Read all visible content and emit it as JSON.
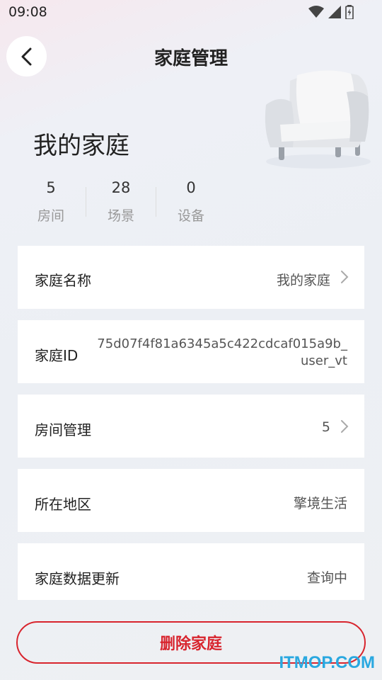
{
  "status_bar": {
    "time": "09:08"
  },
  "header": {
    "title": "家庭管理"
  },
  "home": {
    "name": "我的家庭"
  },
  "stats": [
    {
      "value": "5",
      "label": "房间"
    },
    {
      "value": "28",
      "label": "场景"
    },
    {
      "value": "0",
      "label": "设备"
    }
  ],
  "rows": {
    "home_name": {
      "label": "家庭名称",
      "value": "我的家庭"
    },
    "home_id": {
      "label": "家庭ID",
      "value_line1": "75d07f4f81a6345a5c422cdcaf015a9b_",
      "value_line2": "user_vt"
    },
    "room_management": {
      "label": "房间管理",
      "value": "5"
    },
    "region": {
      "label": "所在地区",
      "value": "擎境生活"
    },
    "data_update": {
      "label": "家庭数据更新",
      "value": "查询中"
    }
  },
  "delete_button": {
    "label": "删除家庭"
  },
  "watermark": {
    "text": "ITMOP.COM"
  },
  "colors": {
    "accent_red": "#d8242d",
    "watermark_blue": "#29a8e0"
  }
}
